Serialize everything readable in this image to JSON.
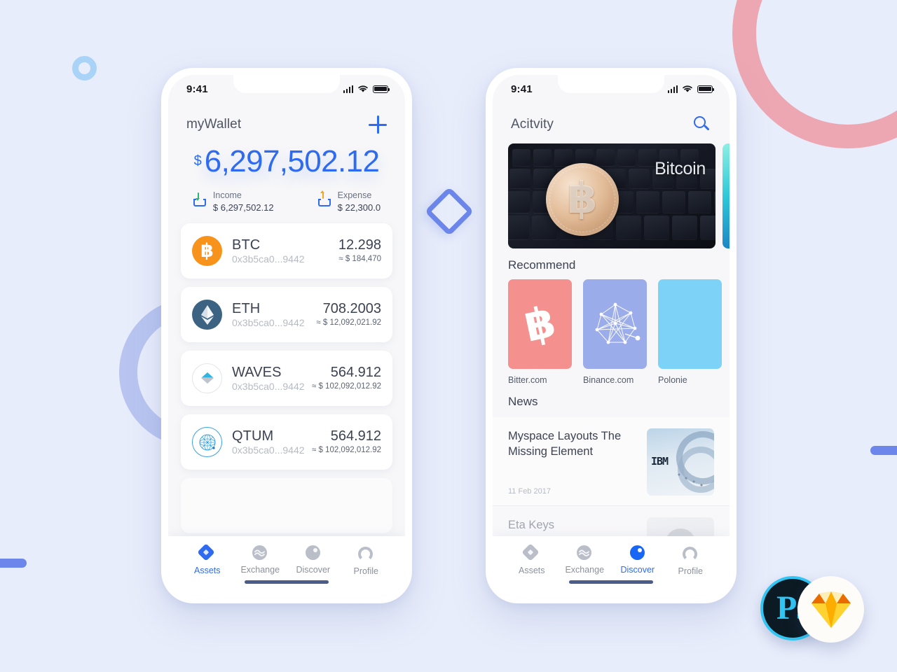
{
  "statusbar": {
    "time": "9:41"
  },
  "wallet": {
    "title": "myWallet",
    "add_label": "+",
    "currency_symbol": "$",
    "balance": "6,297,502.12",
    "flows": [
      {
        "icon": "download-tray-icon",
        "label": "Income",
        "value": "$ 6,297,502.12"
      },
      {
        "icon": "upload-tray-icon",
        "label": "Expense",
        "value": "$ 22,300.0"
      }
    ],
    "assets": [
      {
        "icon": "bitcoin-coin-icon",
        "symbol": "BTC",
        "address": "0x3b5ca0...9442",
        "amount": "12.298",
        "fiat": "≈ $ 184,470"
      },
      {
        "icon": "ethereum-coin-icon",
        "symbol": "ETH",
        "address": "0x3b5ca0...9442",
        "amount": "708.2003",
        "fiat": "≈ $ 12,092,021.92"
      },
      {
        "icon": "waves-coin-icon",
        "symbol": "WAVES",
        "address": "0x3b5ca0...9442",
        "amount": "564.912",
        "fiat": "≈ $ 102,092,012.92"
      },
      {
        "icon": "qtum-coin-icon",
        "symbol": "QTUM",
        "address": "0x3b5ca0...9442",
        "amount": "564.912",
        "fiat": "≈ $ 102,092,012.92"
      }
    ]
  },
  "discover": {
    "title": "Acitvity",
    "search_icon": "search-icon",
    "hero": {
      "caption": "Bitcoin"
    },
    "recommend_title": "Recommend",
    "recommend": [
      {
        "label": "Bitter.com",
        "color": "#f4918f"
      },
      {
        "label": "Binance.com",
        "color": "#9bacea"
      },
      {
        "label": "Polonie",
        "color": "#7dd3f7"
      }
    ],
    "news_title": "News",
    "news": [
      {
        "title": "Myspace Layouts The Missing Element",
        "date": "11 Feb 2017"
      },
      {
        "title": "Eta Keys",
        "date": ""
      }
    ]
  },
  "tabbar": {
    "items": [
      {
        "icon": "assets-diamond-icon",
        "label": "Assets"
      },
      {
        "icon": "exchange-wave-icon",
        "label": "Exchange"
      },
      {
        "icon": "discover-compass-icon",
        "label": "Discover"
      },
      {
        "icon": "profile-person-icon",
        "label": "Profile"
      }
    ],
    "active_left": "Assets",
    "active_right": "Discover"
  },
  "badges": [
    {
      "name": "photoshop-badge",
      "label": "Ps"
    },
    {
      "name": "sketch-badge",
      "label": ""
    }
  ],
  "colors": {
    "background": "#e8edfb",
    "accent": "#2f6bf0",
    "accent_soft": "#6c86ec",
    "pink_ring": "#eda7b2",
    "periwinkle_ring": "#b9c5f0",
    "light_blue_ring": "#a9d3f7"
  }
}
